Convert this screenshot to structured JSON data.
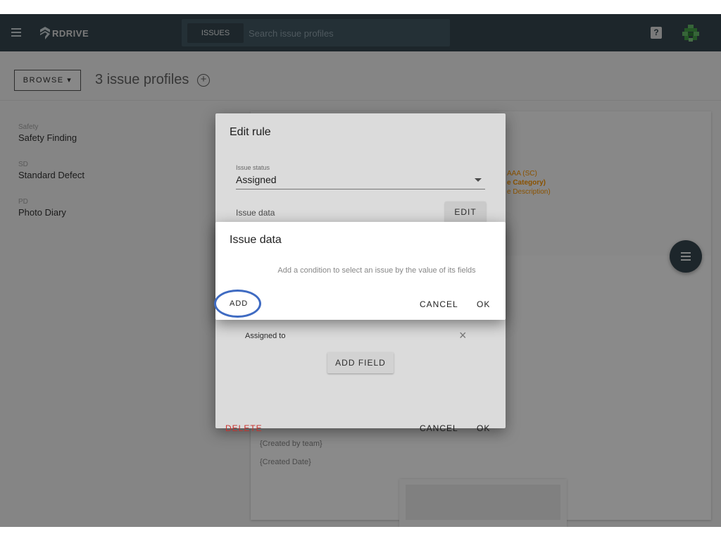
{
  "header": {
    "menu_icon": "hamburger-menu-icon",
    "logo_text": "RDRIVE",
    "search_tab": "ISSUES",
    "search_placeholder": "Search issue profiles",
    "help_icon_text": "?",
    "colors": {
      "topbar": "#37474f",
      "search": "#455a64"
    }
  },
  "page": {
    "browse_label": "BROWSE ▾",
    "title": "3 issue profiles",
    "add_icon": "⊕"
  },
  "sidebar": {
    "items": [
      {
        "abbr": "Safety",
        "name": "Safety Finding"
      },
      {
        "abbr": "SD",
        "name": "Standard Defect"
      },
      {
        "abbr": "PD",
        "name": "Photo Diary"
      }
    ]
  },
  "background": {
    "orange_lines": [
      "AAA (SC)",
      "e Category)",
      "e Description)"
    ],
    "fields": [
      "{Created by team}",
      "{Created Date}"
    ],
    "accent": "#ff9800"
  },
  "edit_rule_dialog": {
    "title": "Edit rule",
    "status_label": "Issue status",
    "status_value": "Assigned",
    "issue_data_label": "Issue data",
    "edit_button": "EDIT",
    "field_label": "Assigned to",
    "remove_icon": "×",
    "add_field_button": "ADD FIELD",
    "delete_button": "DELETE",
    "cancel_button": "CANCEL",
    "ok_button": "OK",
    "delete_color": "#e53935"
  },
  "issue_data_dialog": {
    "title": "Issue data",
    "description": "Add a condition to select an issue by the value of its fields",
    "add_button": "ADD",
    "cancel_button": "CANCEL",
    "ok_button": "OK",
    "highlight_color": "#3f6bc2"
  }
}
